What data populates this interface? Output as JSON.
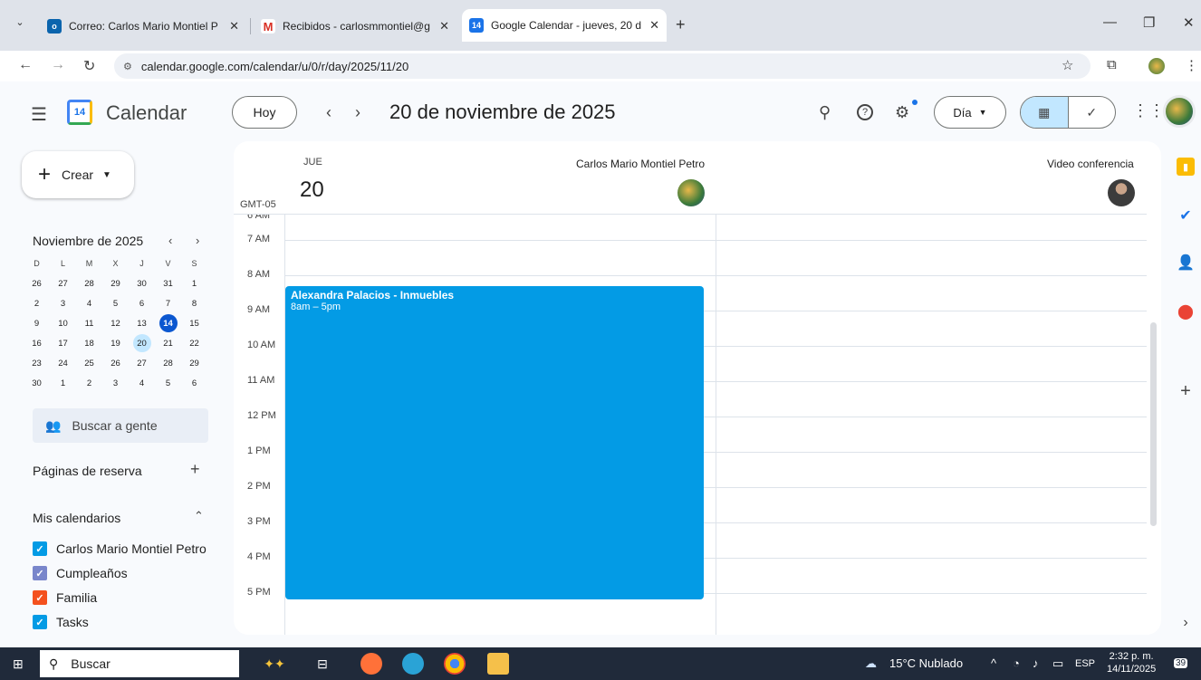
{
  "browser": {
    "tabs": [
      {
        "title": "Correo: Carlos Mario Montiel P",
        "icon": "outlook-icon",
        "active": false
      },
      {
        "title": "Recibidos - carlosmmontiel@g",
        "icon": "gmail-icon",
        "active": false
      },
      {
        "title": "Google Calendar - jueves, 20 d",
        "icon": "calendar-favicon",
        "active": true
      }
    ],
    "new_tab": "+",
    "url": "calendar.google.com/calendar/u/0/r/day/2025/11/20"
  },
  "header": {
    "app_name": "Calendar",
    "logo_day": "14",
    "today_label": "Hoy",
    "date_title": "20 de noviembre de 2025",
    "view_label": "Día"
  },
  "sidebar": {
    "create_label": "Crear",
    "mini_calendar": {
      "title": "Noviembre de 2025",
      "weekdays": [
        "D",
        "L",
        "M",
        "X",
        "J",
        "V",
        "S"
      ],
      "weeks": [
        [
          "26",
          "27",
          "28",
          "29",
          "30",
          "31",
          "1"
        ],
        [
          "2",
          "3",
          "4",
          "5",
          "6",
          "7",
          "8"
        ],
        [
          "9",
          "10",
          "11",
          "12",
          "13",
          "14",
          "15"
        ],
        [
          "16",
          "17",
          "18",
          "19",
          "20",
          "21",
          "22"
        ],
        [
          "23",
          "24",
          "25",
          "26",
          "27",
          "28",
          "29"
        ],
        [
          "30",
          "1",
          "2",
          "3",
          "4",
          "5",
          "6"
        ]
      ],
      "today": "14",
      "selected": "20"
    },
    "people_search": "Buscar a gente",
    "booking_pages": "Páginas de reserva",
    "my_calendars": "Mis calendarios",
    "calendars": [
      {
        "name": "Carlos Mario Montiel Petro",
        "color": "#039be5"
      },
      {
        "name": "Cumpleaños",
        "color": "#7986cb"
      },
      {
        "name": "Familia",
        "color": "#f4511e"
      },
      {
        "name": "Tasks",
        "color": "#039be5"
      }
    ]
  },
  "day_view": {
    "day_abbr": "JUE",
    "day_num": "20",
    "timezone": "GMT-05",
    "columns": [
      {
        "name": "Carlos Mario Montiel Petro"
      },
      {
        "name": "Video conferencia"
      }
    ],
    "hours": [
      "6 AM",
      "7 AM",
      "8 AM",
      "9 AM",
      "10 AM",
      "11 AM",
      "12 PM",
      "1 PM",
      "2 PM",
      "3 PM",
      "4 PM",
      "5 PM"
    ],
    "event": {
      "title": "Alexandra Palacios - Inmuebles",
      "time": "8am – 5pm",
      "color": "#039be5"
    }
  },
  "taskbar": {
    "search": "Buscar",
    "weather": "15°C Nublado",
    "language": "ESP",
    "time": "2:32 p. m.",
    "date": "14/11/2025",
    "notifications": "39"
  }
}
